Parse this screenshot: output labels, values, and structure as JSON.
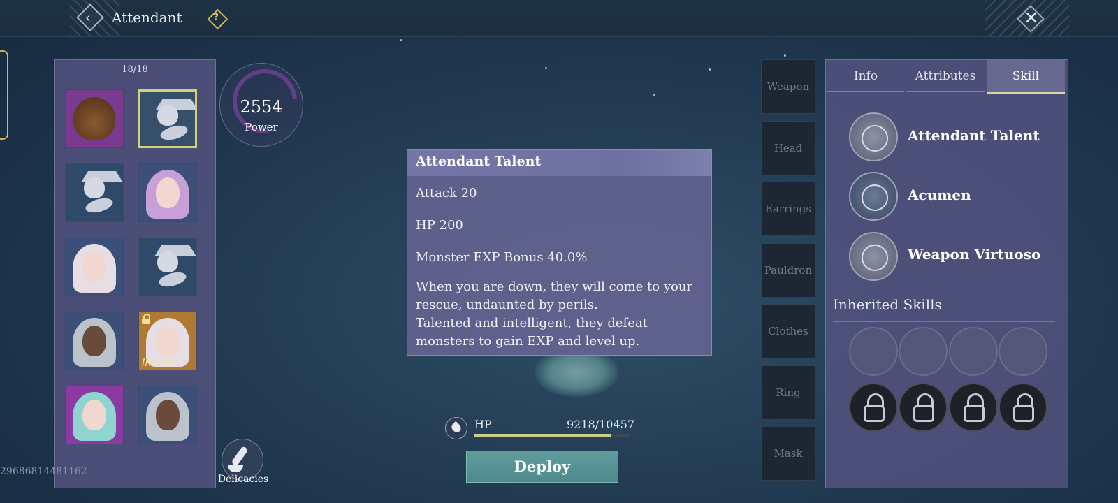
{
  "header": {
    "title": "Attendant"
  },
  "roster": {
    "count": "18/18",
    "uid": "29686814481162",
    "slots": [
      {
        "kind": "bear",
        "bg": "#7a3a8e"
      },
      {
        "kind": "creature",
        "bg": "#36506c",
        "selected": true
      },
      {
        "kind": "creature",
        "bg": "#2f4a68"
      },
      {
        "kind": "girl-purple",
        "bg": "#3c4f78"
      },
      {
        "kind": "girl-white",
        "bg": "#3c4f78"
      },
      {
        "kind": "creature",
        "bg": "#2f4a68"
      },
      {
        "kind": "elder",
        "bg": "#3c4f78"
      },
      {
        "kind": "girl-white",
        "bg": "#b07a35",
        "badge": "In Use",
        "locked": true
      },
      {
        "kind": "girl-teal",
        "bg": "#8a3aa0"
      },
      {
        "kind": "elder",
        "bg": "#3c4f78"
      }
    ]
  },
  "power": {
    "value": "2554",
    "label": "Power"
  },
  "delicacies": {
    "label": "Delicacies"
  },
  "tooltip": {
    "title": "Attendant Talent",
    "lines": [
      "Attack 20",
      "HP 200",
      "Monster EXP Bonus 40.0%"
    ],
    "desc1": "When you are down, they will come to your rescue, undaunted by perils.",
    "desc2": "Talented and intelligent, they defeat monsters to gain EXP and level up."
  },
  "hp": {
    "label": "HP",
    "value": "9218/10457",
    "fraction": 0.8815
  },
  "deploy_label": "Deploy",
  "equipment": [
    "Weapon",
    "Head",
    "Earrings",
    "Pauldron",
    "Clothes",
    "Ring",
    "Mask"
  ],
  "tabs": [
    "Info",
    "Attributes",
    "Skill"
  ],
  "active_tab": "Skill",
  "skills": [
    "Attendant Talent",
    "Acumen",
    "Weapon Virtuoso"
  ],
  "inherited": {
    "title": "Inherited Skills",
    "empty_slots": 4,
    "locked_slots": 4
  },
  "colors": {
    "accent_gold": "#d8d070",
    "deploy": "#5f9c9c",
    "hp_bar": "#c9cf88"
  }
}
